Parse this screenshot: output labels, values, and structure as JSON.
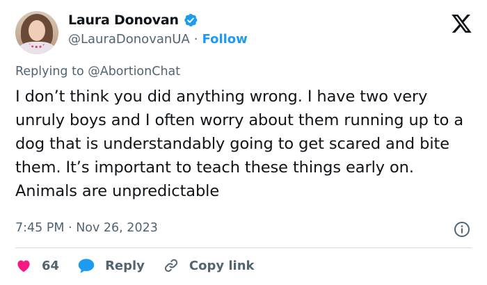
{
  "author": {
    "display_name": "Laura Donovan",
    "handle": "@LauraDonovanUA",
    "follow_label": "Follow",
    "verified": true
  },
  "reply_context": {
    "text": "Replying to @AbortionChat"
  },
  "tweet": {
    "text": "I don’t think you did anything wrong. I have two very unruly boys and I often worry about them running up to a dog that is understandably going to get scared and bite them. It’s important to teach these things early on. Animals are unpredictable",
    "timestamp": "7:45 PM · Nov 26, 2023"
  },
  "actions": {
    "like_count": "64",
    "reply_label": "Reply",
    "copy_label": "Copy link"
  },
  "colors": {
    "brand_blue": "#1d9bf0",
    "like_red": "#f91880",
    "text_primary": "#0f1419",
    "text_secondary": "#536471",
    "divider": "#cfd9de"
  },
  "icons": {
    "logo": "x-logo-icon",
    "verified": "verified-badge-icon",
    "info": "info-icon",
    "like": "heart-icon",
    "reply": "reply-bubble-icon",
    "copy": "link-icon"
  }
}
